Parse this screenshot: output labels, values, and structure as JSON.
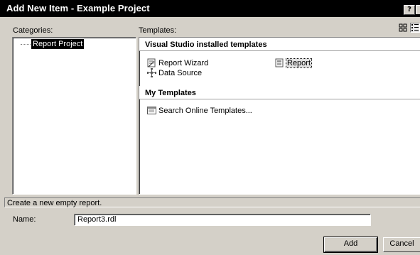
{
  "window": {
    "title": "Add New Item - Example Project",
    "help_label": "?"
  },
  "categories": {
    "label": "Categories:",
    "items": [
      {
        "label": "Report Project",
        "selected": true
      }
    ]
  },
  "templates": {
    "label": "Templates:",
    "groups": [
      {
        "header": "Visual Studio installed templates",
        "items": [
          {
            "label": "Report Wizard",
            "icon": "report-wizard-icon"
          },
          {
            "label": "Report",
            "icon": "report-icon",
            "selected": true
          },
          {
            "label": "Data Source",
            "icon": "data-source-icon"
          }
        ]
      },
      {
        "header": "My Templates",
        "items": [
          {
            "label": "Search Online Templates...",
            "icon": "search-online-icon"
          }
        ]
      }
    ],
    "view_modes": [
      "large-icons",
      "small-icons"
    ]
  },
  "description": "Create a new empty report.",
  "name_field": {
    "label": "Name:",
    "value": "Report3.rdl"
  },
  "buttons": {
    "add": "Add",
    "cancel": "Cancel"
  }
}
